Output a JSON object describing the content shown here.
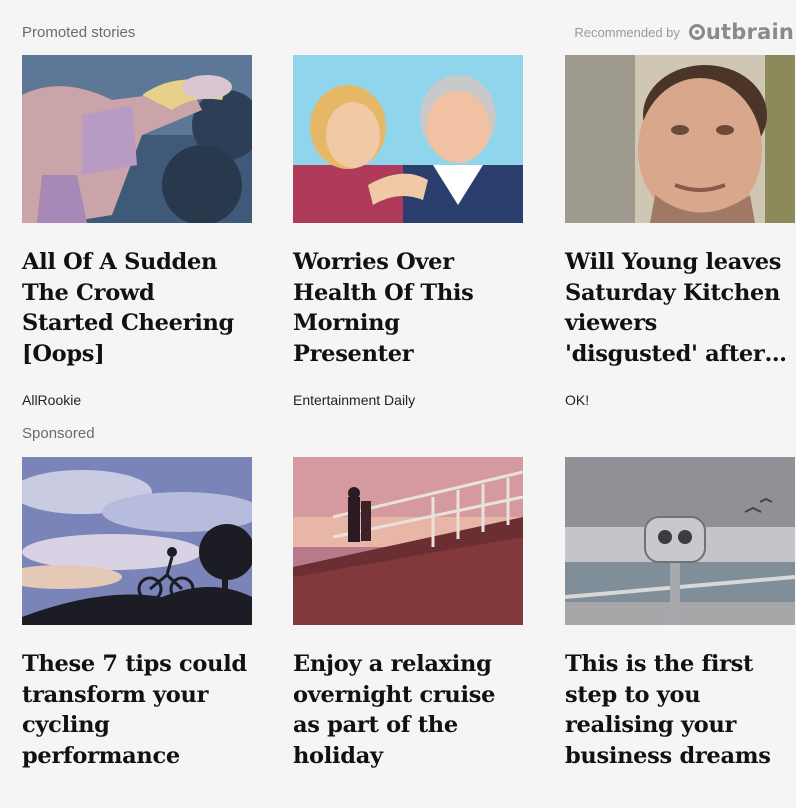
{
  "header": {
    "promoted_label": "Promoted stories",
    "recommended_label": "Recommended by",
    "brand": "Outbrain"
  },
  "sponsored_label": "Sponsored",
  "cards": [
    {
      "headline": "All Of A Sudden The Crowd Started Cheering [Oops]",
      "source": "AllRookie",
      "image": "tennis-player-photo"
    },
    {
      "headline": "Worries Over Health Of This Morning Presenter",
      "source": "Entertainment Daily",
      "image": "presenters-photo"
    },
    {
      "headline": "Will Young leaves Saturday Kitchen viewers 'disgusted' after…",
      "source": "OK!",
      "image": "man-portrait-photo"
    },
    {
      "headline": "These 7 tips could transform your cycling performance",
      "image": "cyclist-silhouette-photo"
    },
    {
      "headline": "Enjoy a relaxing overnight cruise as part of the holiday",
      "image": "cruise-deck-photo"
    },
    {
      "headline": "This is the first step to you realising your business dreams",
      "image": "binocular-viewer-photo"
    }
  ],
  "colors": {
    "background": "#f5f5f5",
    "headline": "#111111",
    "label": "#6b6b6b"
  }
}
